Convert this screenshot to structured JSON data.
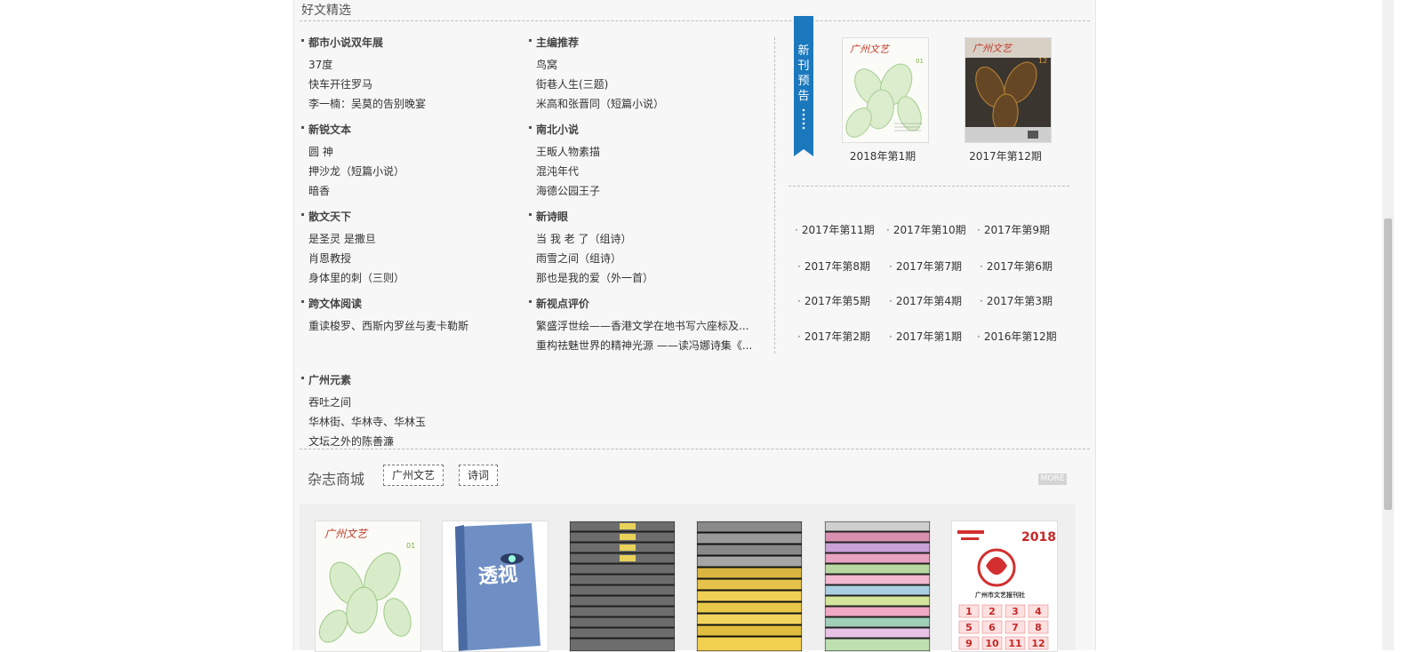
{
  "section": {
    "title": "好文精选"
  },
  "left_categories": [
    {
      "title": "都市小说双年展",
      "items": [
        "37度",
        "快车开往罗马",
        "李一楠：吴莫的告别晚宴"
      ]
    },
    {
      "title": "新锐文本",
      "items": [
        "圆 神",
        "押沙龙（短篇小说）",
        "暗香"
      ]
    },
    {
      "title": "散文天下",
      "items": [
        "是圣灵 是撒旦",
        "肖恩教授",
        "身体里的刺（三则）"
      ]
    },
    {
      "title": "跨文体阅读",
      "items": [
        "重读梭罗、西斯内罗丝与麦卡勒斯"
      ]
    },
    {
      "title": "广州元素",
      "items": [
        "吞吐之间",
        "华林街、华林寺、华林玉",
        "文坛之外的陈善濂"
      ]
    }
  ],
  "mid_categories": [
    {
      "title": "主编推荐",
      "items": [
        "鸟窝",
        "街巷人生(三题)",
        "米高和张晋同（短篇小说）"
      ]
    },
    {
      "title": "南北小说",
      "items": [
        "王畈人物素描",
        "混沌年代",
        "海德公园王子"
      ]
    },
    {
      "title": "新诗眼",
      "items": [
        "当 我 老 了（组诗）",
        "雨雪之间（组诗）",
        "那也是我的爱（外一首）"
      ]
    },
    {
      "title": "新视点评价",
      "items": [
        "繁盛浮世绘——香港文学在地书写六座标及...",
        "重构祛魅世界的精神光源 ——读冯娜诗集《..."
      ]
    }
  ],
  "new_issue": {
    "ribbon_text": [
      "新",
      "刊",
      "预",
      "告"
    ],
    "covers": [
      {
        "label": "2018年第1期",
        "logo": "广州文艺",
        "num": "01"
      },
      {
        "label": "2017年第12期",
        "logo": "广州文艺",
        "num": "12"
      }
    ]
  },
  "archive_issues": [
    "2017年第11期",
    "2017年第10期",
    "2017年第9期",
    "2017年第8期",
    "2017年第7期",
    "2017年第6期",
    "2017年第5期",
    "2017年第4期",
    "2017年第3期",
    "2017年第2期",
    "2017年第1期",
    "2016年第12期"
  ],
  "mall": {
    "title": "杂志商城",
    "tabs": [
      "广州文艺",
      "诗词"
    ],
    "more_label": "MORE",
    "products": [
      {
        "name": "广州文艺-cover",
        "logo": "广州文艺",
        "num": "01"
      },
      {
        "name": "透视",
        "title": "透视"
      },
      {
        "name": "广州文艺-stack-grey"
      },
      {
        "name": "广州文艺-stack-yellow"
      },
      {
        "name": "广州文艺-stack-pink"
      },
      {
        "name": "calendar-2018",
        "year": "2018",
        "org": "广州市文艺报刊社"
      }
    ]
  }
}
